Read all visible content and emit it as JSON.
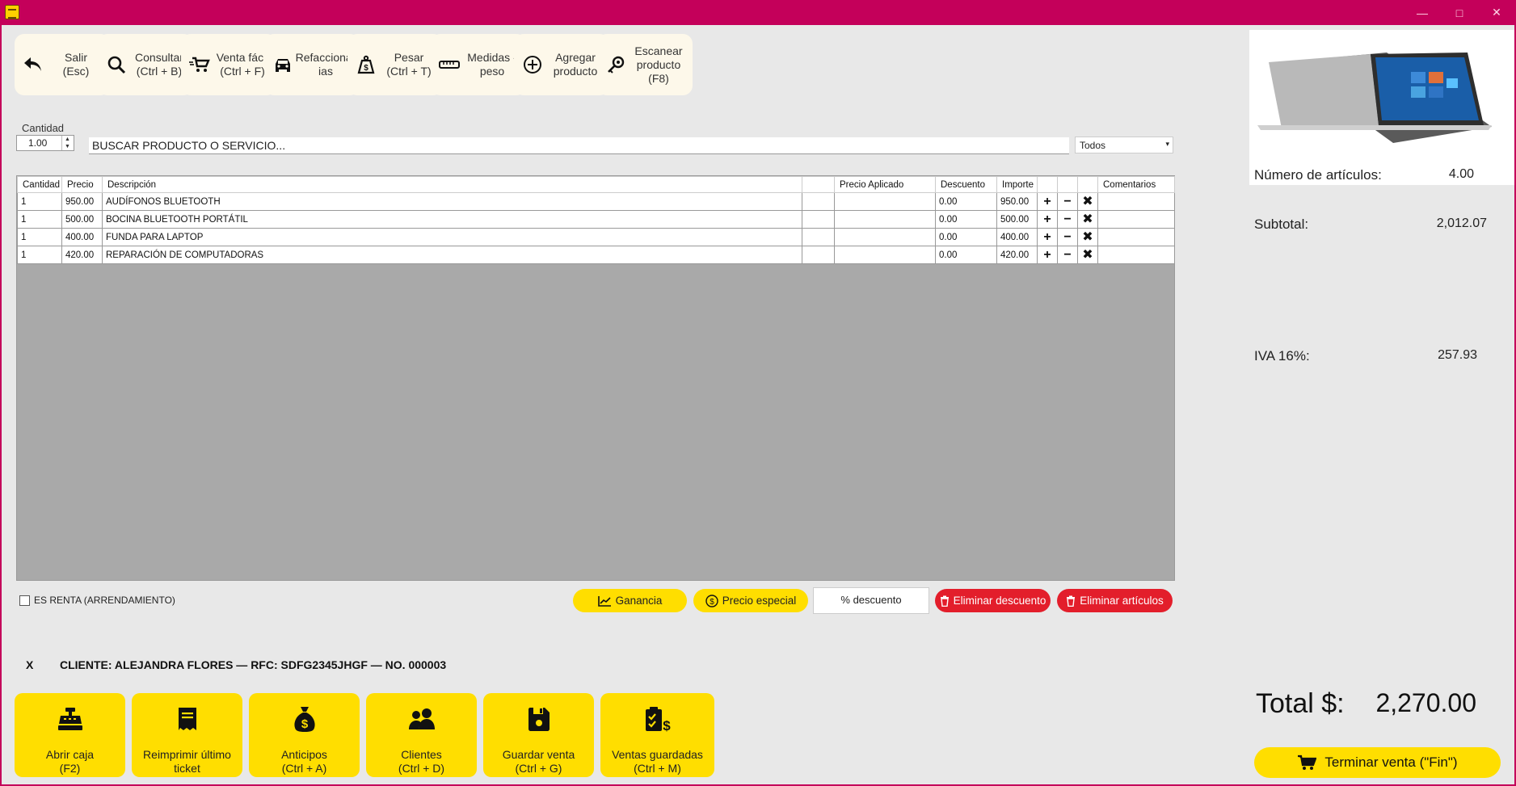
{
  "window": {
    "minimize": "—",
    "maximize": "□",
    "close": "✕"
  },
  "toolbar": [
    {
      "id": "salir",
      "label": "Salir\n(Esc)",
      "icon": "undo-arrow-icon"
    },
    {
      "id": "consultar",
      "label": "Consultar\n(Ctrl + B)",
      "icon": "search-icon"
    },
    {
      "id": "venta-facil",
      "label": "Venta fácil\n(Ctrl + F)",
      "icon": "cart-fast-icon"
    },
    {
      "id": "refaccionarias",
      "label": "Refaccionar\nias",
      "icon": "car-icon"
    },
    {
      "id": "pesar",
      "label": "Pesar\n(Ctrl + T)",
      "icon": "weight-icon"
    },
    {
      "id": "medidas",
      "label": "Medidas -\npeso",
      "icon": "ruler-icon"
    },
    {
      "id": "agregar",
      "label": "Agregar\nproducto",
      "icon": "plus-circle-icon"
    },
    {
      "id": "escanear",
      "label": "Escanear\nproducto\n(F8)",
      "icon": "key-icon"
    }
  ],
  "quantity": {
    "label": "Cantidad",
    "value": "1.00",
    "spin_up": "▲",
    "spin_down": "▼"
  },
  "search": {
    "value": "BUSCAR PRODUCTO O SERVICIO..."
  },
  "filter": {
    "selected": "Todos",
    "arrow": "▾"
  },
  "table": {
    "columns": [
      "Cantidad",
      "Precio",
      "Descripción",
      "",
      "Precio Aplicado",
      "Descuento",
      "Importe",
      "",
      "",
      "",
      "Comentarios"
    ],
    "rows": [
      {
        "cantidad": "1",
        "precio": "950.00",
        "descripcion": "AUDÍFONOS BLUETOOTH",
        "precio_aplicado": "",
        "descuento": "0.00",
        "importe": "950.00",
        "comentarios": ""
      },
      {
        "cantidad": "1",
        "precio": "500.00",
        "descripcion": "BOCINA BLUETOOTH PORTÁTIL",
        "precio_aplicado": "",
        "descuento": "0.00",
        "importe": "500.00",
        "comentarios": ""
      },
      {
        "cantidad": "1",
        "precio": "400.00",
        "descripcion": "FUNDA PARA LAPTOP",
        "precio_aplicado": "",
        "descuento": "0.00",
        "importe": "400.00",
        "comentarios": ""
      },
      {
        "cantidad": "1",
        "precio": "420.00",
        "descripcion": "REPARACIÓN DE COMPUTADORAS",
        "precio_aplicado": "",
        "descuento": "0.00",
        "importe": "420.00",
        "comentarios": ""
      }
    ],
    "row_actions": {
      "add": "+",
      "remove": "−",
      "delete": "✖"
    }
  },
  "renta": {
    "label": "ES RENTA (ARRENDAMIENTO)",
    "checked": false
  },
  "actions": {
    "ganancia": "Ganancia",
    "precio_especial": "Precio especial",
    "descuento_placeholder": "% descuento",
    "eliminar_descuento": "Eliminar descuento",
    "eliminar_articulos": "Eliminar artículos"
  },
  "cliente": {
    "clear": "X",
    "line": "CLIENTE: ALEJANDRA FLORES — RFC: SDFG2345JHGF — NO. 000003"
  },
  "bottom_buttons": [
    {
      "id": "abrir-caja",
      "label": "Abrir caja\n(F2)",
      "icon": "cash-register-icon"
    },
    {
      "id": "reimprimir",
      "label": "Reimprimir último\nticket",
      "icon": "receipt-icon"
    },
    {
      "id": "anticipos",
      "label": "Anticipos\n(Ctrl + A)",
      "icon": "money-bag-icon"
    },
    {
      "id": "clientes",
      "label": "Clientes\n(Ctrl + D)",
      "icon": "users-icon"
    },
    {
      "id": "guardar-venta",
      "label": "Guardar venta\n(Ctrl + G)",
      "icon": "save-icon"
    },
    {
      "id": "ventas-guardadas",
      "label": "Ventas guardadas\n(Ctrl + M)",
      "icon": "clipboard-money-icon"
    }
  ],
  "summary": {
    "articulos_label": "Número de artículos:",
    "articulos_value": "4.00",
    "subtotal_label": "Subtotal:",
    "subtotal_value": "2,012.07",
    "iva_label": "IVA 16%:",
    "iva_value": "257.93",
    "total_label": "Total $:",
    "total_value": "2,270.00",
    "finish_label": "Terminar venta (\"Fin\")"
  },
  "colors": {
    "titlebar": "#c4005a",
    "accent_yellow": "#ffde00",
    "danger_red": "#e31e2b",
    "background": "#e8e8e8"
  }
}
